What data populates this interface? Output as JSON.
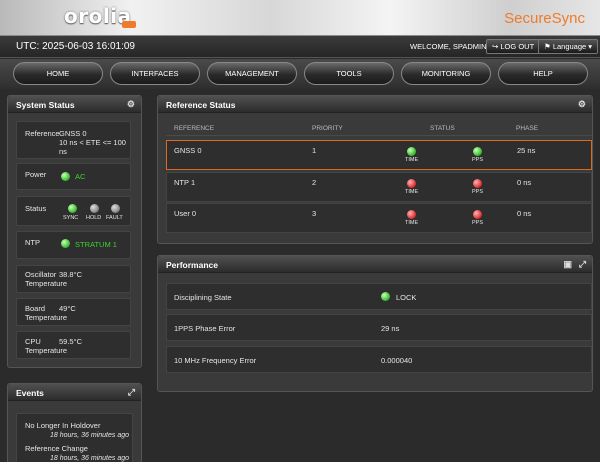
{
  "header": {
    "logo": "orolia",
    "product": "SecureSync",
    "utc": "UTC: 2025-06-03 16:01:09",
    "welcome": "WELCOME, SPADMIN",
    "logout_label": "LOG OUT",
    "language_label": "Language"
  },
  "nav": [
    "HOME",
    "INTERFACES",
    "MANAGEMENT",
    "TOOLS",
    "MONITORING",
    "HELP"
  ],
  "system_status": {
    "title": "System Status",
    "reference_label": "Reference",
    "reference_value": "GNSS 0",
    "reference_detail": "10 ns < ETE <= 100 ns",
    "power_label": "Power",
    "power_value": "AC",
    "status_label": "Status",
    "status_leds": [
      "SYNC",
      "HOLD",
      "FAULT"
    ],
    "ntp_label": "NTP",
    "ntp_value": "STRATUM 1",
    "osc_label_1": "Oscillator",
    "osc_label_2": "Temperature",
    "osc_value": "38.8°C",
    "board_label_1": "Board",
    "board_label_2": "Temperature",
    "board_value": "49°C",
    "cpu_label_1": "CPU",
    "cpu_label_2": "Temperature",
    "cpu_value": "59.5°C"
  },
  "events": {
    "title": "Events",
    "items": [
      {
        "text": "No Longer In Holdover",
        "time": "18 hours, 36 minutes ago"
      },
      {
        "text": "Reference Change",
        "time": "18 hours, 36 minutes ago"
      }
    ]
  },
  "reference_status": {
    "title": "Reference Status",
    "columns": [
      "REFERENCE",
      "PRIORITY",
      "STATUS",
      "PHASE"
    ],
    "led_labels": [
      "TIME",
      "PPS"
    ],
    "rows": [
      {
        "reference": "GNSS 0",
        "priority": "1",
        "time": "green",
        "pps": "green",
        "phase": "25 ns"
      },
      {
        "reference": "NTP 1",
        "priority": "2",
        "time": "red",
        "pps": "red",
        "phase": "0 ns"
      },
      {
        "reference": "User 0",
        "priority": "3",
        "time": "red",
        "pps": "red",
        "phase": "0 ns"
      }
    ]
  },
  "performance": {
    "title": "Performance",
    "rows": [
      {
        "label": "Disciplining State",
        "value": "LOCK"
      },
      {
        "label": "1PPS Phase Error",
        "value": "29 ns"
      },
      {
        "label": "10 MHz Frequency Error",
        "value": "0.000040"
      }
    ]
  },
  "colors": {
    "accent": "#f07a2a",
    "ok": "#3fd12f",
    "alarm": "#e23a3a"
  }
}
